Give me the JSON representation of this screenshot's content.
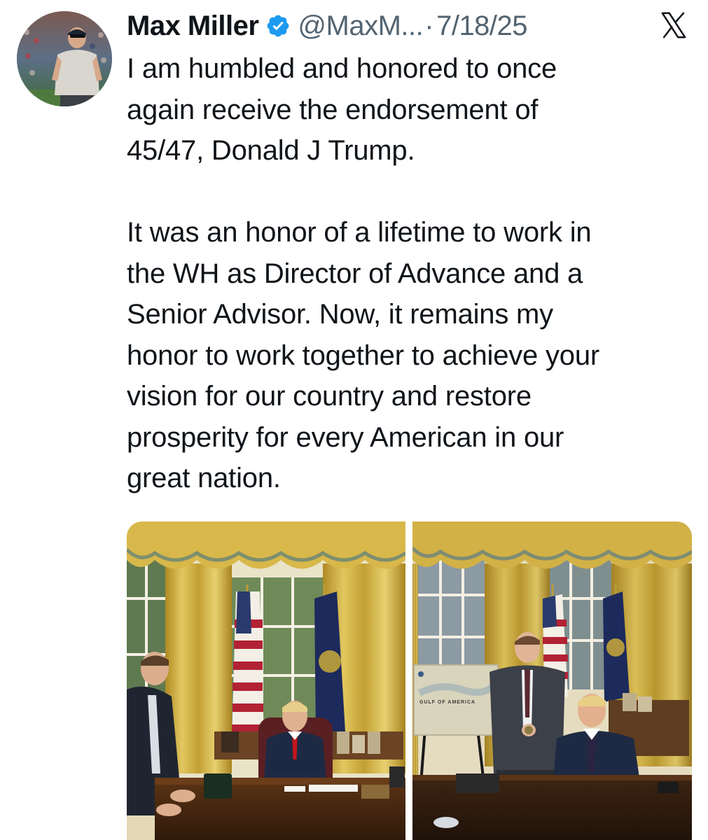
{
  "author": {
    "name": "Max Miller",
    "handle": "@MaxM...",
    "separator": "·",
    "date": "7/18/25",
    "verified": true
  },
  "platform_icon": "x-logo-icon",
  "post": {
    "paragraphs": [
      {
        "lines": [
          "I am humbled and honored to once",
          "again receive the endorsement of",
          "45/47, Donald J Trump."
        ]
      },
      {
        "lines": [
          "It was an honor of a lifetime to work in",
          "the WH as Director of Advance and  a",
          "Senior Advisor. Now, it remains my",
          "honor to work together to achieve your",
          "vision for our country and restore",
          "prosperity for every American in our",
          "great nation."
        ]
      }
    ]
  },
  "media": {
    "photo_1": {
      "map_label": ""
    },
    "photo_2": {
      "map_label": "GULF OF AMERICA"
    }
  },
  "colors": {
    "text": "#0f1419",
    "muted": "#536471",
    "verified_blue": "#1d9bf0",
    "curtain_gold": "#c9a93a"
  }
}
